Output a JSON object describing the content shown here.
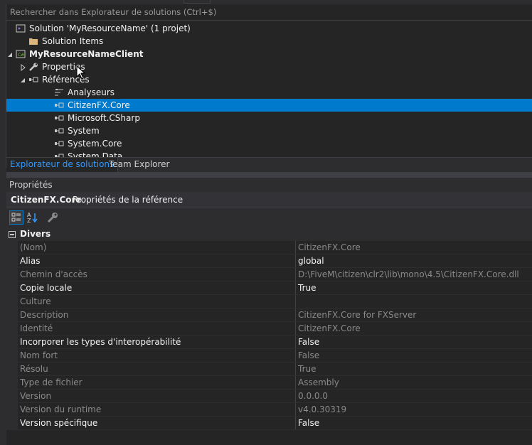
{
  "colors": {
    "accent": "#007acc",
    "tab_active_text": "#3399ff",
    "background": "#252526",
    "readonly_text": "#8a8a8a"
  },
  "solution_explorer": {
    "search_placeholder": "Rechercher dans Explorateur de solutions (Ctrl+$)",
    "tree": [
      {
        "label": "Solution 'MyResourceName' (1 projet)",
        "icon": "solution-icon",
        "level": 0,
        "bold": false,
        "expander": "none",
        "selected": false
      },
      {
        "label": "Solution Items",
        "icon": "folder-icon",
        "level": 1,
        "bold": false,
        "expander": "none",
        "selected": false
      },
      {
        "label": "MyResourceNameClient",
        "icon": "csharp-project-icon",
        "level": 0,
        "bold": true,
        "expander": "expanded",
        "selected": false
      },
      {
        "label": "Properties",
        "icon": "wrench-icon",
        "level": 1,
        "bold": false,
        "expander": "collapsed",
        "selected": false
      },
      {
        "label": "Références",
        "icon": "references-icon",
        "level": 1,
        "bold": false,
        "expander": "expanded",
        "selected": false
      },
      {
        "label": "Analyseurs",
        "icon": "analyzers-icon",
        "level": 2,
        "bold": false,
        "expander": "none",
        "selected": false
      },
      {
        "label": "CitizenFX.Core",
        "icon": "reference-icon",
        "level": 2,
        "bold": false,
        "expander": "none",
        "selected": true
      },
      {
        "label": "Microsoft.CSharp",
        "icon": "reference-icon",
        "level": 2,
        "bold": false,
        "expander": "none",
        "selected": false
      },
      {
        "label": "System",
        "icon": "reference-icon",
        "level": 2,
        "bold": false,
        "expander": "none",
        "selected": false
      },
      {
        "label": "System.Core",
        "icon": "reference-icon",
        "level": 2,
        "bold": false,
        "expander": "none",
        "selected": false
      },
      {
        "label": "System.Data",
        "icon": "reference-icon",
        "level": 2,
        "bold": false,
        "expander": "none",
        "selected": false
      }
    ],
    "tabs": [
      {
        "label": "Explorateur de solutions",
        "active": true
      },
      {
        "label": "Team Explorer",
        "active": false
      }
    ]
  },
  "properties": {
    "title": "Propriétés",
    "object_name": "CitizenFX.Core",
    "object_desc": "Propriétés de la référence",
    "toolbar": [
      {
        "icon": "categorized-icon",
        "active": true
      },
      {
        "icon": "alphabetical-icon",
        "active": false
      },
      {
        "icon": "property-pages-icon",
        "active": false
      }
    ],
    "category": "Divers",
    "rows": [
      {
        "name": "(Nom)",
        "value": "CitizenFX.Core",
        "readonly": true
      },
      {
        "name": "Alias",
        "value": "global",
        "readonly": false
      },
      {
        "name": "Chemin d'accès",
        "value": "D:\\FiveM\\citizen\\clr2\\lib\\mono\\4.5\\CitizenFX.Core.dll",
        "readonly": true
      },
      {
        "name": "Copie locale",
        "value": "True",
        "readonly": false
      },
      {
        "name": "Culture",
        "value": "",
        "readonly": true
      },
      {
        "name": "Description",
        "value": "CitizenFX.Core for FXServer",
        "readonly": true
      },
      {
        "name": "Identité",
        "value": "CitizenFX.Core",
        "readonly": true
      },
      {
        "name": "Incorporer les types d'interopérabilité",
        "value": "False",
        "readonly": false
      },
      {
        "name": "Nom fort",
        "value": "False",
        "readonly": true
      },
      {
        "name": "Résolu",
        "value": "True",
        "readonly": true
      },
      {
        "name": "Type de fichier",
        "value": "Assembly",
        "readonly": true
      },
      {
        "name": "Version",
        "value": "0.0.0.0",
        "readonly": true
      },
      {
        "name": "Version du runtime",
        "value": "v4.0.30319",
        "readonly": true
      },
      {
        "name": "Version spécifique",
        "value": "False",
        "readonly": false
      }
    ]
  }
}
